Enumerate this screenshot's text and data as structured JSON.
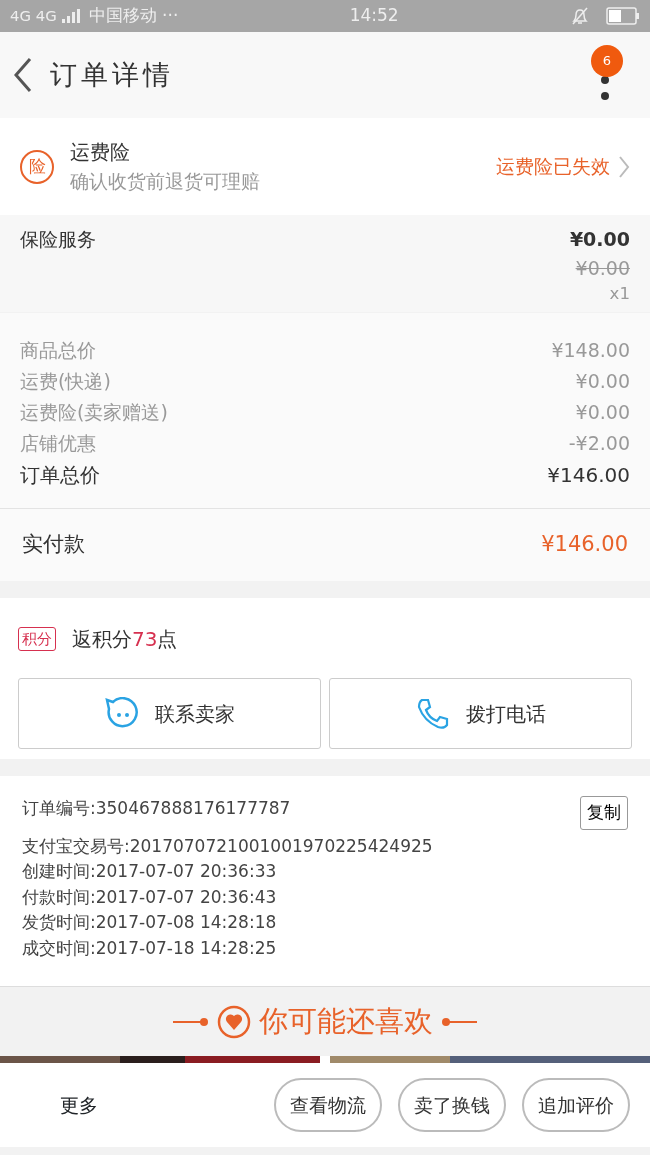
{
  "status_bar": {
    "network": "4G 4G",
    "carrier": "中国移动 ···",
    "time": "14:52"
  },
  "header": {
    "title": "订单详情",
    "badge": "6"
  },
  "insurance": {
    "badge": "险",
    "title": "运费险",
    "subtitle": "确认收货前退货可理赔",
    "status": "运费险已失效"
  },
  "service": {
    "label": "保险服务",
    "price": "¥0.00",
    "original_price": "¥0.00",
    "quantity": "x1"
  },
  "price_lines": [
    {
      "label": "商品总价",
      "value": "¥148.00",
      "kind": "minor"
    },
    {
      "label": "运费(快递)",
      "value": "¥0.00",
      "kind": "minor"
    },
    {
      "label": "运费险(卖家赠送)",
      "value": "¥0.00",
      "kind": "minor"
    },
    {
      "label": "店铺优惠",
      "value": "-¥2.00",
      "kind": "minor"
    },
    {
      "label": "订单总价",
      "value": "¥146.00",
      "kind": "total"
    }
  ],
  "paid": {
    "label": "实付款",
    "value": "¥146.00"
  },
  "points": {
    "tag": "积分",
    "prefix": "返积分",
    "amount": "73",
    "suffix": "点"
  },
  "contact_buttons": [
    {
      "label": "联系卖家",
      "kind": "chat"
    },
    {
      "label": "拨打电话",
      "kind": "phone"
    }
  ],
  "order_info": {
    "copy_button": "复制",
    "lines": [
      "订单编号:350467888176177787",
      "支付宝交易号:2017070721001001970225424925",
      "创建时间:2017-07-07 20:36:33",
      "付款时间:2017-07-07 20:36:43",
      "发货时间:2017-07-08 14:28:18",
      "成交时间:2017-07-18 14:28:25"
    ]
  },
  "recommend": {
    "title": "你可能还喜欢"
  },
  "bottom_bar": {
    "more": "更多",
    "buttons": [
      "查看物流",
      "卖了换钱",
      "追加评价"
    ]
  }
}
